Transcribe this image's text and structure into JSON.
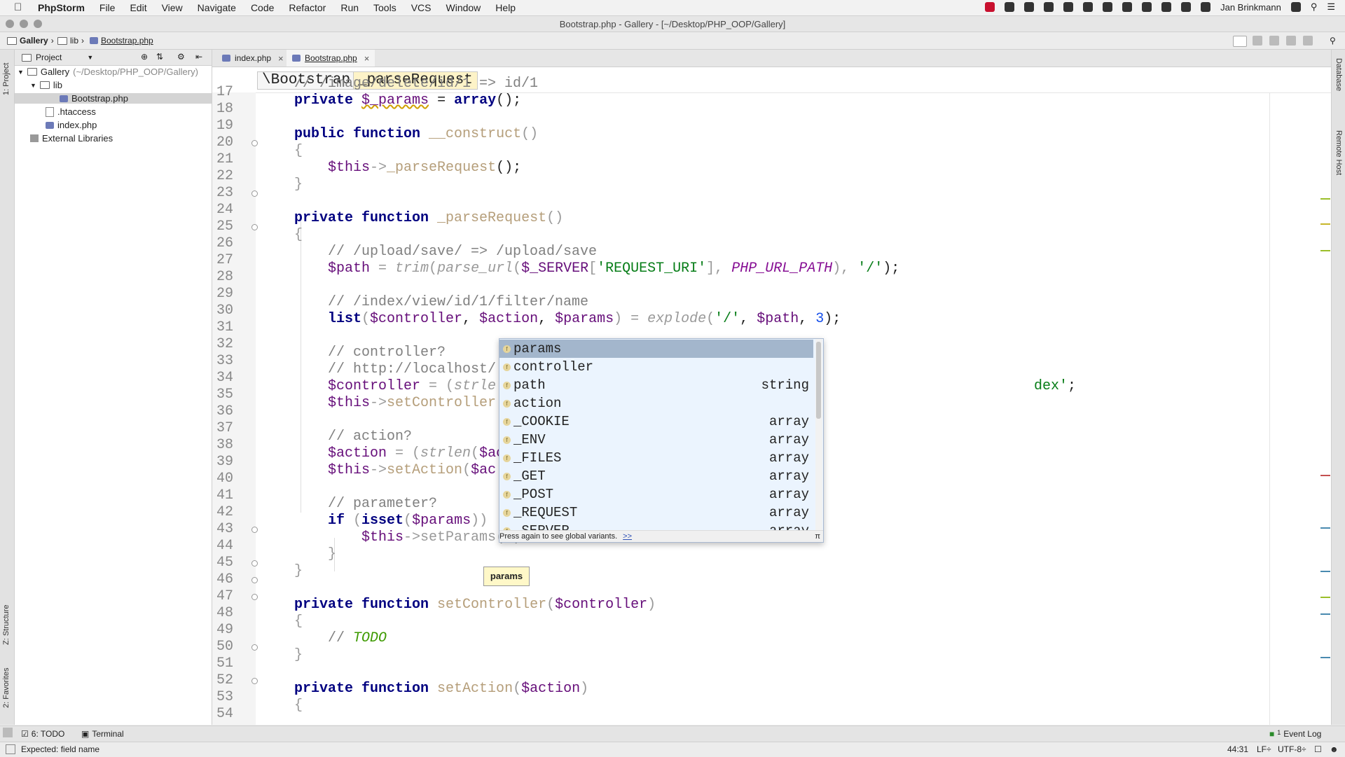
{
  "menubar": {
    "app": "PhpStorm",
    "menus": [
      "File",
      "Edit",
      "View",
      "Navigate",
      "Code",
      "Refactor",
      "Run",
      "Tools",
      "VCS",
      "Window",
      "Help"
    ],
    "user": "Jan Brinkmann"
  },
  "window": {
    "title": "Bootstrap.php - Gallery - [~/Desktop/PHP_OOP/Gallery]"
  },
  "navbar": {
    "crumbs": [
      "Gallery",
      "lib",
      "Bootstrap.php"
    ]
  },
  "left_strip": {
    "project": "1: Project",
    "structure": "Z: Structure",
    "favorites": "2: Favorites"
  },
  "right_strip": {
    "database": "Database",
    "remote_host": "Remote Host"
  },
  "project_panel": {
    "header": "Project",
    "root": "Gallery",
    "root_path": "(~/Desktop/PHP_OOP/Gallery)",
    "items": [
      "lib",
      "Bootstrap.php",
      ".htaccess",
      "index.php",
      "External Libraries"
    ]
  },
  "tabs": [
    {
      "label": "index.php",
      "active": false
    },
    {
      "label": "Bootstrap.php",
      "active": true
    }
  ],
  "code_breadcrumb": [
    "\\Bootstrap",
    "_parseRequest"
  ],
  "line_numbers": [
    "17",
    "18",
    "19",
    "20",
    "21",
    "22",
    "23",
    "24",
    "25",
    "26",
    "27",
    "28",
    "29",
    "30",
    "31",
    "32",
    "33",
    "34",
    "35",
    "36",
    "37",
    "38",
    "39",
    "40",
    "41",
    "42",
    "43",
    "44",
    "45",
    "46",
    "47",
    "48",
    "49",
    "50",
    "51",
    "52",
    "53",
    "54"
  ],
  "code": {
    "l17": "// /image/delete/id/1 => id/1",
    "l18a": "private",
    "l18b": "$_params",
    "l18c": "=",
    "l18d": "array",
    "l18e": "();",
    "l20a": "public function",
    "l20b": "__construct",
    "l20c": "()",
    "l21": "{",
    "l22a": "$this",
    "l22b": "->",
    "l22c": "_parseRequest",
    "l22d": "();",
    "l23": "}",
    "l25a": "private function",
    "l25b": "_parseRequest",
    "l25c": "()",
    "l26": "{",
    "l27": "// /upload/save/ => /upload/save",
    "l28a": "$path",
    "l28b": " = ",
    "l28c": "trim",
    "l28d": "(",
    "l28e": "parse_url",
    "l28f": "(",
    "l28g": "$_SERVER",
    "l28h": "[",
    "l28i": "'REQUEST_URI'",
    "l28j": "], ",
    "l28k": "PHP_URL_PATH",
    "l28l": "), ",
    "l28m": "'/'",
    "l28n": ");",
    "l30": "// /index/view/id/1/filter/name",
    "l31a": "list",
    "l31b": "(",
    "l31c": "$controller",
    "l31d": ", ",
    "l31e": "$action",
    "l31f": ", ",
    "l31g": "$params",
    "l31h": ") = ",
    "l31i": "explode",
    "l31j": "(",
    "l31k": "'/'",
    "l31l": ", ",
    "l31m": "$path",
    "l31n": ", ",
    "l31o": "3",
    "l31p": ");",
    "l33": "// controller?",
    "l34": "// http://localhost/",
    "l35a": "$controller",
    "l35b": " = (",
    "l35c": "strle",
    "l35d": "dex'",
    "l35e": ";",
    "l36a": "$this",
    "l36b": "->",
    "l36c": "setController",
    "l38": "// action?",
    "l39a": "$action",
    "l39b": " = (",
    "l39c": "strlen",
    "l39d": "(",
    "l39e": "$ac",
    "l40a": "$this",
    "l40b": "->",
    "l40c": "setAction",
    "l40d": "(",
    "l40e": "$ac",
    "l42": "// parameter?",
    "l43a": "if",
    "l43b": " (",
    "l43c": "isset",
    "l43d": "(",
    "l43e": "$params",
    "l43f": "))",
    "l44a": "$this",
    "l44b": "->",
    "l44c": "setParams",
    "l44d": "($)",
    "l45": "}",
    "l46": "}",
    "l48a": "private function",
    "l48b": "setController",
    "l48c": "(",
    "l48d": "$controller",
    "l48e": ")",
    "l49": "{",
    "l50a": "//",
    "l50b": "TODO",
    "l51": "}",
    "l53a": "private function",
    "l53b": "setAction",
    "l53c": "(",
    "l53d": "$action",
    "l53e": ")",
    "l54": "{"
  },
  "autocomplete": {
    "items": [
      {
        "name": "params",
        "type": ""
      },
      {
        "name": "controller",
        "type": ""
      },
      {
        "name": "path",
        "type": "string"
      },
      {
        "name": "action",
        "type": ""
      },
      {
        "name": "_COOKIE",
        "type": "array"
      },
      {
        "name": "_ENV",
        "type": "array"
      },
      {
        "name": "_FILES",
        "type": "array"
      },
      {
        "name": "_GET",
        "type": "array"
      },
      {
        "name": "_POST",
        "type": "array"
      },
      {
        "name": "_REQUEST",
        "type": "array"
      },
      {
        "name": "_SERVER",
        "type": "array"
      }
    ],
    "footer": "Press again to see global variants.",
    "footer_link": ">>",
    "pin": "π"
  },
  "tooltip": "params",
  "bottom_bar": {
    "todo": "6: TODO",
    "terminal": "Terminal",
    "event_log": "Event Log",
    "event_count": "1"
  },
  "status_bar": {
    "message": "Expected: field name",
    "position": "44:31",
    "line_sep": "LF÷",
    "encoding": "UTF-8÷"
  },
  "colors": {
    "selection": "#a3b6cc",
    "popup_bg": "#ebf4fe",
    "tooltip_bg": "#fff8c8",
    "keyword": "#000080",
    "variable": "#660e7a"
  }
}
